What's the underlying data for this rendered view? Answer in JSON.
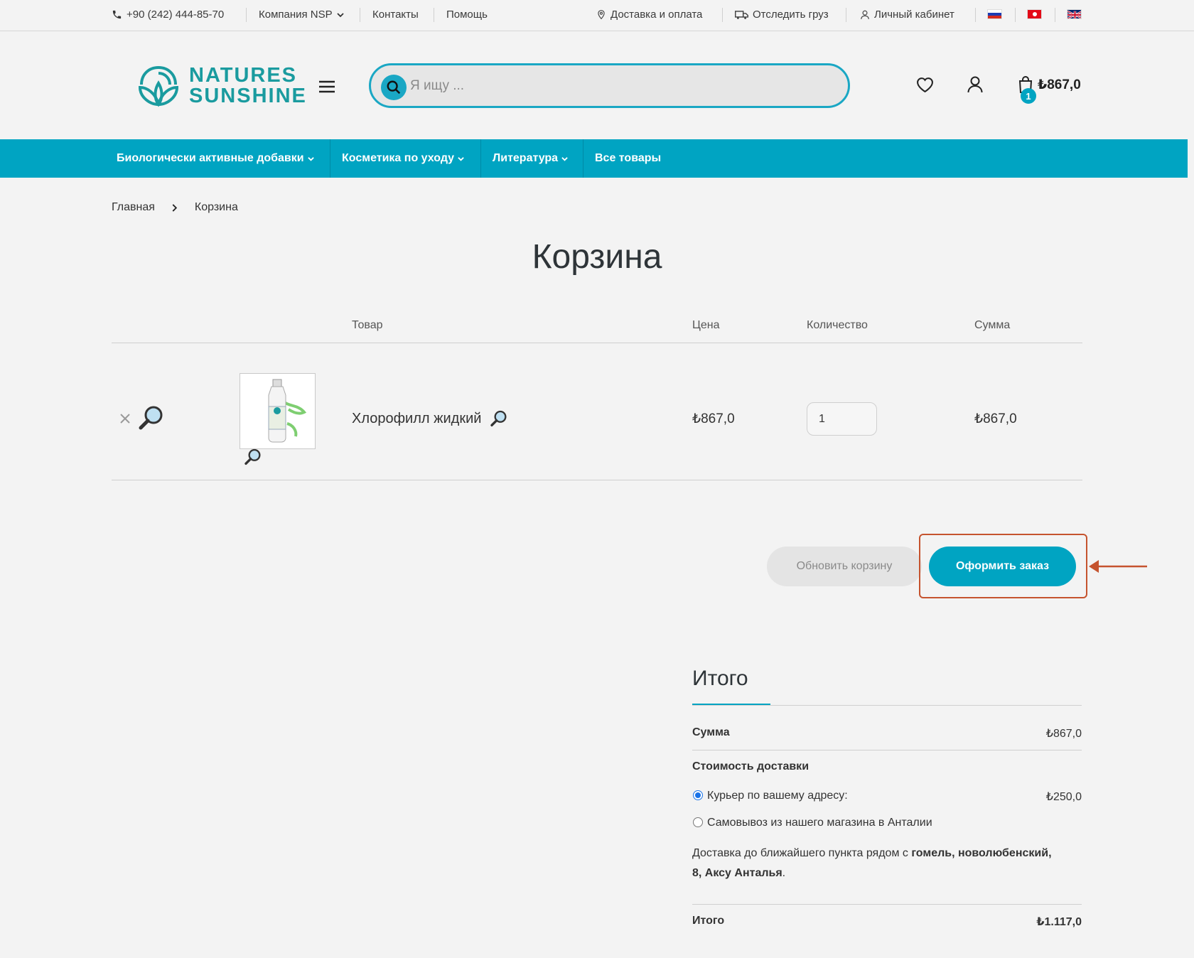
{
  "topbar": {
    "phone": "+90 (242) 444-85-70",
    "company": "Компания NSP",
    "contacts": "Контакты",
    "help": "Помощь",
    "delivery": "Доставка и оплата",
    "track": "Отследить груз",
    "account": "Личный кабинет"
  },
  "header": {
    "logo_line1": "NATURES",
    "logo_line2": "SUNSHINE",
    "search_placeholder": "Я ищу ...",
    "cart_count": "1",
    "cart_total": "₺867,0"
  },
  "nav": [
    {
      "label": "Биологически активные добавки"
    },
    {
      "label": "Косметика по уходу"
    },
    {
      "label": "Литература"
    },
    {
      "label": "Все товары"
    }
  ],
  "breadcrumb": {
    "home": "Главная",
    "current": "Корзина"
  },
  "page_title": "Корзина",
  "cart_table": {
    "headers": {
      "product": "Товар",
      "price": "Цена",
      "quantity": "Количество",
      "subtotal": "Сумма"
    },
    "items": [
      {
        "name": "Хлорофилл жидкий",
        "price": "₺867,0",
        "quantity": "1",
        "subtotal": "₺867,0"
      }
    ]
  },
  "actions": {
    "update": "Обновить корзину",
    "checkout": "Оформить заказ"
  },
  "totals": {
    "title": "Итого",
    "subtotal_label": "Сумма",
    "subtotal_value": "₺867,0",
    "shipping_label": "Стоимость доставки",
    "shipping_options": [
      {
        "label": "Курьер по вашему адресу:",
        "value": "₺250,0",
        "selected": true
      },
      {
        "label": "Самовывоз из нашего магазина в Анталии",
        "value": "",
        "selected": false
      }
    ],
    "shipping_note_prefix": "Доставка до ближайшего пункта рядом с",
    "shipping_note_address1": "гомель, новолюбенский,",
    "shipping_note_address2": "8, Аксу Анталья",
    "shipping_note_suffix": ".",
    "total_label": "Итого",
    "total_value": "₺1.117,0"
  },
  "colors": {
    "brand": "#00a4c2",
    "logo": "#1a9b9f",
    "highlight": "#c5532e"
  }
}
